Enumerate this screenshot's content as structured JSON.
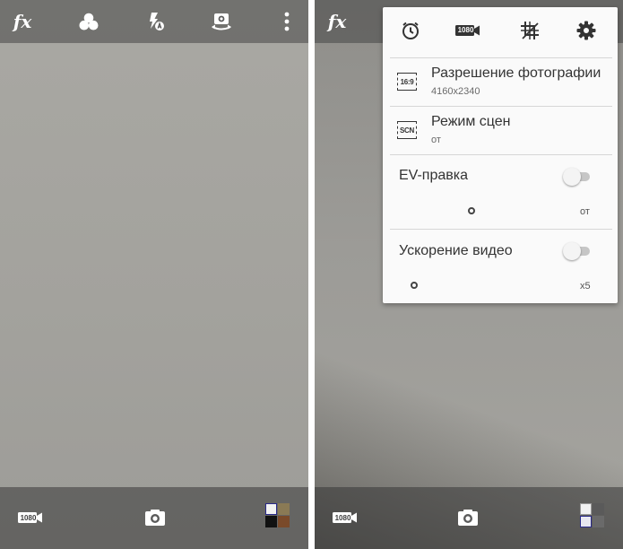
{
  "left_screen": {
    "top_bar": {
      "fx_label": "fx",
      "icons": [
        "fx-icon",
        "color-filter-icon",
        "flash-auto-icon",
        "switch-camera-icon",
        "more-vert-icon"
      ]
    },
    "bottom_bar": {
      "video_label": "1080",
      "icons": [
        "video-1080-icon",
        "shutter-camera-icon",
        "gallery-thumbnail"
      ]
    }
  },
  "right_screen": {
    "top_bar": {
      "fx_label": "fx"
    },
    "settings_panel": {
      "icons": [
        "timer-icon",
        "video-1080-icon",
        "grid-crop-icon",
        "gear-icon"
      ],
      "video_label": "1080",
      "rows": [
        {
          "badge": "16:9",
          "title": "Разрешение фотографии",
          "subtitle": "4160x2340"
        },
        {
          "badge": "SCN",
          "title": "Режим сцен",
          "subtitle": "от"
        },
        {
          "title": "EV-правка",
          "value": "от",
          "toggle_on": false
        },
        {
          "title": "Ускорение видео",
          "value": "x5",
          "toggle_on": false
        }
      ]
    },
    "bottom_bar": {
      "video_label": "1080",
      "icons": [
        "video-1080-icon",
        "shutter-camera-icon",
        "gallery-thumbnail"
      ]
    }
  },
  "colors": {
    "bar_overlay": "#464646",
    "panel_bg": "#fafafa",
    "panel_text": "#333333",
    "toggle_track": "#c6c6c6"
  }
}
